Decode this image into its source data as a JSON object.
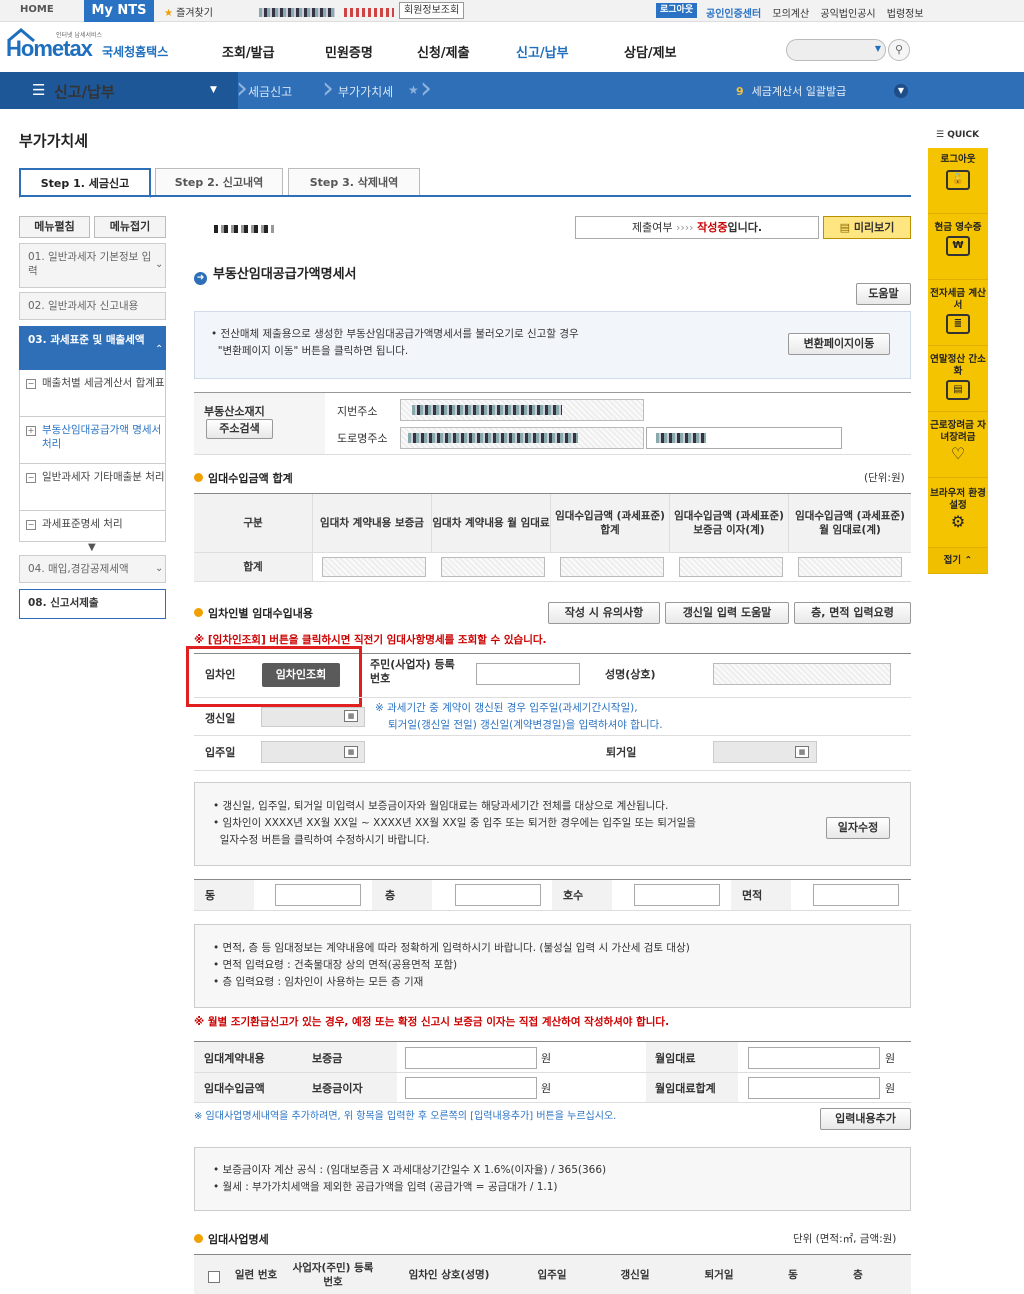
{
  "topbar": {
    "home": "HOME",
    "mynts": "My NTS",
    "favorites": "즐겨찾기",
    "member_info": "회원정보조회",
    "logout": "로그아웃",
    "links": [
      "공인인증센터",
      "모의계산",
      "공익법인공시",
      "법령정보"
    ]
  },
  "header": {
    "logo_text": "Hometax",
    "logo_korean": "국세청홈택스",
    "logo_small": "인터넷 납세서비스",
    "gnb": [
      "조회/발급",
      "민원증명",
      "신청/제출",
      "신고/납부",
      "상담/제보"
    ]
  },
  "nav": {
    "menu": "신고/납부",
    "crumbs": [
      "세금신고",
      "부가가치세"
    ],
    "notice_num": "9",
    "notice": "세금계산서 일괄발급"
  },
  "page": {
    "title": "부가가치세",
    "tabs": [
      "Step 1. 세금신고",
      "Step 2. 신고내역",
      "Step 3. 삭제내역"
    ]
  },
  "sidebar": {
    "expand": "메뉴펼침",
    "collapse": "메뉴접기",
    "items": [
      {
        "label": "01. 일반과세자 기본정보 입력"
      },
      {
        "label": "02. 일반과세자 신고내용"
      },
      {
        "label": "03. 과세표준 및 매출세액"
      },
      {
        "label": "04. 매입,경감공제세액"
      },
      {
        "label": "08. 신고서제출"
      }
    ],
    "subs": [
      {
        "icon": "−",
        "label": "매출처별 세금계산서 합계표"
      },
      {
        "icon": "+",
        "label": "부동산임대공급가액 명세서 처리"
      },
      {
        "icon": "−",
        "label": "일반과세자 기타매출분 처리"
      },
      {
        "icon": "−",
        "label": "과세표준명세 처리"
      }
    ]
  },
  "quick": {
    "label": "QUICK",
    "items": [
      "로그아웃",
      "현금 영수증",
      "전자세금 계산서",
      "연말정산 간소화",
      "근로장려금 자녀장려금",
      "브라우저 환경설정",
      "접기"
    ]
  },
  "submit": {
    "label": "제출여부",
    "status": "작성중",
    "status_suffix": "입니다.",
    "preview": "미리보기"
  },
  "form": {
    "section_title": "부동산임대공급가액명세서",
    "help": "도움말",
    "info_text1": "전산매체 제출용으로 생성한 부동산임대공급가액명세서를 불러오기로 신고할 경우",
    "info_text2": "\"변환페이지 이동\" 버튼을 클릭하면 됩니다.",
    "convert_btn": "변환페이지이동",
    "location_label": "부동산소재지",
    "address_search": "주소검색",
    "lot_address": "지번주소",
    "road_address": "도로명주소",
    "sum_title": "임대수입금액 합계",
    "sum_unit": "(단위:원)",
    "sum_headers": [
      "구분",
      "임대차 계약내용 보증금",
      "임대차 계약내용 월 임대료",
      "임대수입금액 (과세표준) 합계",
      "임대수입금액 (과세표준) 보증금 이자(계)",
      "임대수입금액 (과세표준) 월 임대료(계)"
    ],
    "sum_row": "합계",
    "tenant_title": "임차인별 임대수입내용",
    "btn_caution": "작성 시 유의사항",
    "btn_renew_help": "갱신일 입력 도움말",
    "btn_area_help": "층, 면적 입력요령",
    "red_note1": "※ [임차인조회] 버튼을 클릭하시면 직전기 임대사항명세를 조회할 수 있습니다.",
    "tenant": "임차인",
    "tenant_inquiry": "임차인조회",
    "rrn_label": "주민(사업자) 등록번호",
    "name_label": "성명(상호)",
    "renew_date": "갱신일",
    "renew_note1": "※ 과세기간 중 계약이 갱신된 경우 입주일(과세기간시작일),",
    "renew_note2": "퇴거일(갱신일 전일) 갱신일(계약변경일)을 입력하셔야 합니다.",
    "move_in": "입주일",
    "move_out": "퇴거일",
    "date_note1": "갱신일, 입주일, 퇴거일 미입력시 보증금이자와 월임대료는 해당과세기간 전체를 대상으로 계산됩니다.",
    "date_note2": "임차인이 XXXX년 XX월 XX일 ~ XXXX년 XX월 XX일 중 입주 또는 퇴거한 경우에는 입주일 또는 퇴거일을",
    "date_note3": "일자수정 버튼을 클릭하여 수정하시기 바랍니다.",
    "date_edit": "일자수정",
    "dong": "동",
    "floor": "층",
    "ho": "호수",
    "area": "면적",
    "area_note1": "면적, 층 등 임대정보는 계약내용에 따라 정확하게 입력하시기 바랍니다. (불성실 입력 시 가산세 검토 대상)",
    "area_note2": "면적 입력요령 : 건축물대장 상의 면적(공용면적 포함)",
    "area_note3": "층 입력요령 : 임차인이 사용하는 모든 층 기재",
    "red_note2": "※ 월별 조기환급신고가 있는 경우, 예정 또는 확정 신고시 보증금 이자는 직접 계산하여 작성하셔야 합니다.",
    "contract_label": "임대계약내용",
    "deposit": "보증금",
    "monthly_rent": "월임대료",
    "income_label": "임대수입금액",
    "deposit_interest": "보증금이자",
    "monthly_rent_total": "월임대료합계",
    "won": "원",
    "add_note": "※ 임대사업명세내역을 추가하려면, 위 항목을 입력한 후 오른쪽의 [입력내용추가] 버튼을 누르십시오.",
    "add_btn": "입력내용추가",
    "formula1": "보증금이자 계산 공식 : (임대보증금 X 과세대상기간일수 X 1.6%(이자율) / 365(366)",
    "formula2": "월세 : 부가가치세액을 제외한 공급가액을 입력 (공급가액 = 공급대가 / 1.1)",
    "biz_title": "임대사업명세",
    "biz_unit": "단위 (면적:㎡, 금액:원)",
    "biz_headers": [
      "일련 번호",
      "사업자(주민) 등록번호",
      "임차인 상호(성명)",
      "입주일",
      "갱신일",
      "퇴거일",
      "동",
      "층"
    ]
  },
  "colors": {
    "primary": "#2e6fb8",
    "nav_dark": "#1e5798",
    "quick": "#f5c400",
    "red": "#cc0000",
    "highlight": "#e02020"
  }
}
